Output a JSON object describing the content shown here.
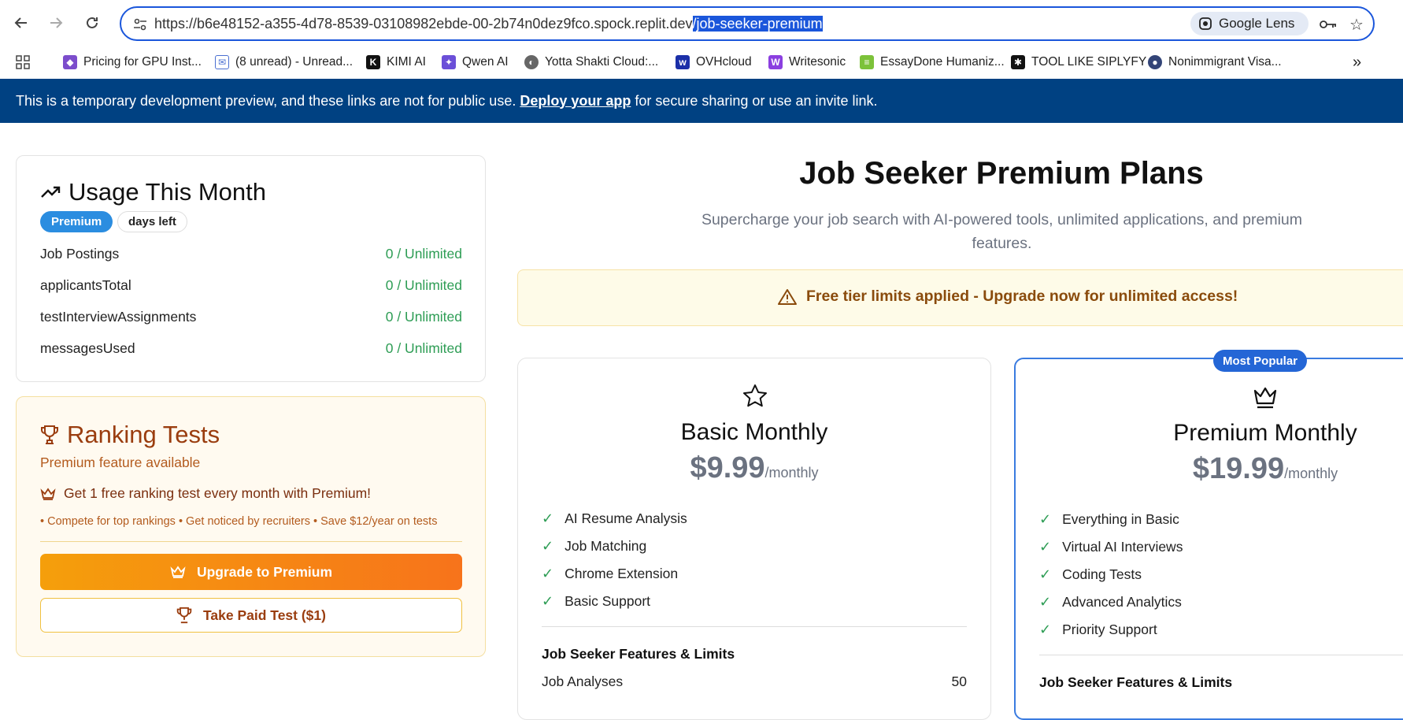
{
  "browser": {
    "url_prefix": "https://b6e48152-a355-4d78-8539-03108982ebde-00-2b74n0dez9fco.spock.replit.dev",
    "url_selected": "/job-seeker-premium",
    "lens_label": "Google Lens",
    "bookmarks": [
      {
        "label": "Pricing for GPU Inst...",
        "icon": "cube-icon",
        "color": "#7c4dcc"
      },
      {
        "label": "(8 unread) - Unread...",
        "icon": "mail-icon",
        "color": "#4a6fd1"
      },
      {
        "label": "KIMI AI",
        "icon": "k-icon",
        "color": "#111111"
      },
      {
        "label": "Qwen AI",
        "icon": "qwen-icon",
        "color": "#6b4fd8"
      },
      {
        "label": "Yotta Shakti Cloud:...",
        "icon": "globe-icon",
        "color": "#666666"
      },
      {
        "label": "OVHcloud",
        "icon": "ovh-icon",
        "color": "#1b2fa8"
      },
      {
        "label": "Writesonic",
        "icon": "ws-icon",
        "color": "#8b3fe0"
      },
      {
        "label": "EssayDone Humaniz...",
        "icon": "doc-icon",
        "color": "#7cc23a"
      },
      {
        "label": "TOOL LIKE SIPLYFY",
        "icon": "tool-icon",
        "color": "#111111"
      },
      {
        "label": "Nonimmigrant Visa...",
        "icon": "seal-icon",
        "color": "#334477"
      }
    ]
  },
  "banner": {
    "text_before": "This is a temporary development preview, and these links are not for public use. ",
    "link": "Deploy your app",
    "text_after": " for secure sharing or use an invite link."
  },
  "usage": {
    "title": "Usage This Month",
    "badge": "Premium",
    "days_left": "days left",
    "rows": [
      {
        "label": "Job Postings",
        "value": "0 / Unlimited"
      },
      {
        "label": "applicantsTotal",
        "value": "0 / Unlimited"
      },
      {
        "label": "testInterviewAssignments",
        "value": "0 / Unlimited"
      },
      {
        "label": "messagesUsed",
        "value": "0 / Unlimited"
      }
    ]
  },
  "ranking": {
    "title": "Ranking Tests",
    "subtitle": "Premium feature available",
    "offer": "Get 1 free ranking test every month with Premium!",
    "bullets": "• Compete for top rankings • Get noticed by recruiters • Save $12/year on tests",
    "upgrade_label": "Upgrade to Premium",
    "paid_label": "Take Paid Test ($1)"
  },
  "main": {
    "title": "Job Seeker Premium Plans",
    "subtitle": "Supercharge your job search with AI-powered tools, unlimited applications, and premium features.",
    "alert": "Free tier limits applied - Upgrade now for unlimited access!"
  },
  "plans": {
    "basic": {
      "name": "Basic Monthly",
      "price": "$9.99",
      "period": "/monthly",
      "features": [
        "AI Resume Analysis",
        "Job Matching",
        "Chrome Extension",
        "Basic Support"
      ],
      "limits_title": "Job Seeker Features & Limits",
      "limits": [
        {
          "label": "Job Analyses",
          "value": "50"
        }
      ]
    },
    "premium": {
      "badge": "Most Popular",
      "name": "Premium Monthly",
      "price": "$19.99",
      "period": "/monthly",
      "features": [
        "Everything in Basic",
        "Virtual AI Interviews",
        "Coding Tests",
        "Advanced Analytics",
        "Priority Support"
      ],
      "limits_title": "Job Seeker Features & Limits"
    }
  }
}
